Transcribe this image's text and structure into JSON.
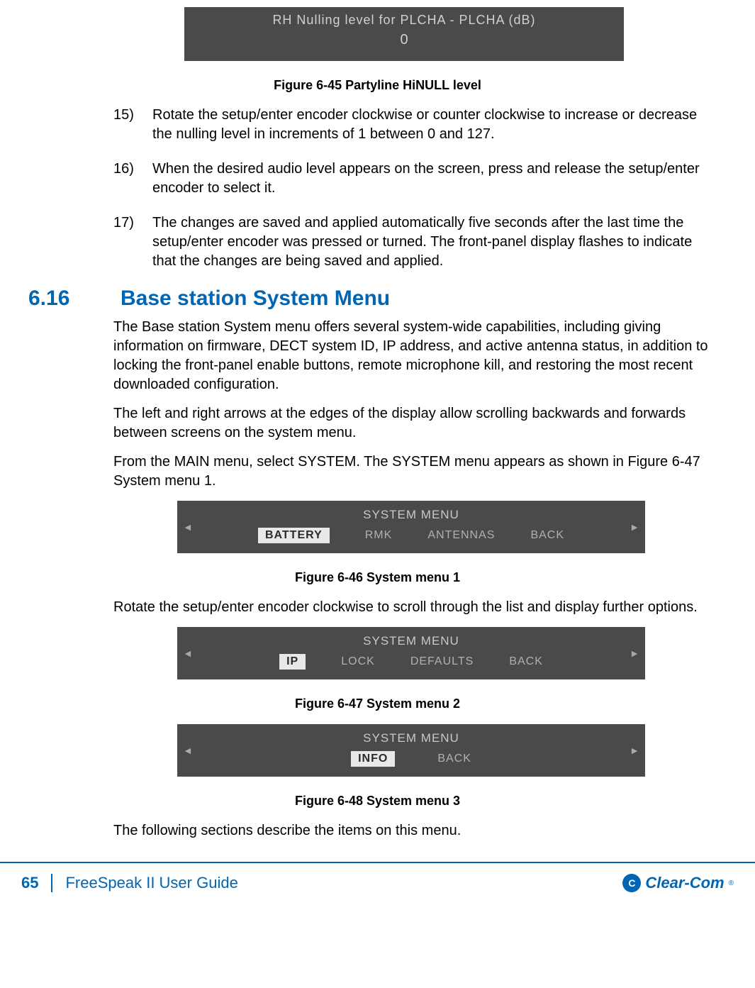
{
  "lcd1": {
    "title": "RH Nulling level for PLCHA - PLCHA (dB)",
    "value": "0"
  },
  "caption1": "Figure 6-45 Partyline HiNULL level",
  "steps": [
    {
      "num": "15)",
      "text": "Rotate the setup/enter encoder clockwise or counter clockwise to increase or decrease the nulling level in increments of 1 between 0 and 127."
    },
    {
      "num": "16)",
      "text": "When the desired audio level appears on the screen, press and release the setup/enter encoder to select it."
    },
    {
      "num": "17)",
      "text": "The changes are saved and applied automatically five seconds after the last time the setup/enter encoder was pressed or turned. The front-panel display flashes to indicate that the changes are being saved and applied."
    }
  ],
  "section": {
    "number": "6.16",
    "title": "Base station System Menu"
  },
  "para1": "The Base station System menu offers several system-wide capabilities, including giving information on firmware, DECT system ID, IP address, and active antenna status, in addition to locking the front-panel enable buttons, remote microphone kill, and restoring the most recent downloaded configuration.",
  "para2": "The left and right arrows at the edges of the display allow scrolling backwards and forwards between screens on the system menu.",
  "para3": "From the MAIN menu, select SYSTEM. The SYSTEM menu appears as shown in Figure 6-47 System menu 1.",
  "menu1": {
    "title": "SYSTEM MENU",
    "selected": "BATTERY",
    "items": [
      "RMK",
      "ANTENNAS",
      "BACK"
    ]
  },
  "caption2": "Figure 6-46 System menu 1",
  "para4": "Rotate the setup/enter encoder clockwise to scroll through the list and display further options.",
  "menu2": {
    "title": "SYSTEM MENU",
    "selected": "IP",
    "items": [
      "LOCK",
      "DEFAULTS",
      "BACK"
    ]
  },
  "caption3": "Figure 6-47 System menu 2",
  "menu3": {
    "title": "SYSTEM MENU",
    "selected": "INFO",
    "items": [
      "BACK"
    ]
  },
  "caption4": "Figure 6-48 System menu 3",
  "para5": "The following sections describe the items on this menu.",
  "footer": {
    "page": "65",
    "doc": "FreeSpeak II User Guide",
    "logo_icon": "C",
    "logo_text": "Clear-Com",
    "reg": "®"
  }
}
